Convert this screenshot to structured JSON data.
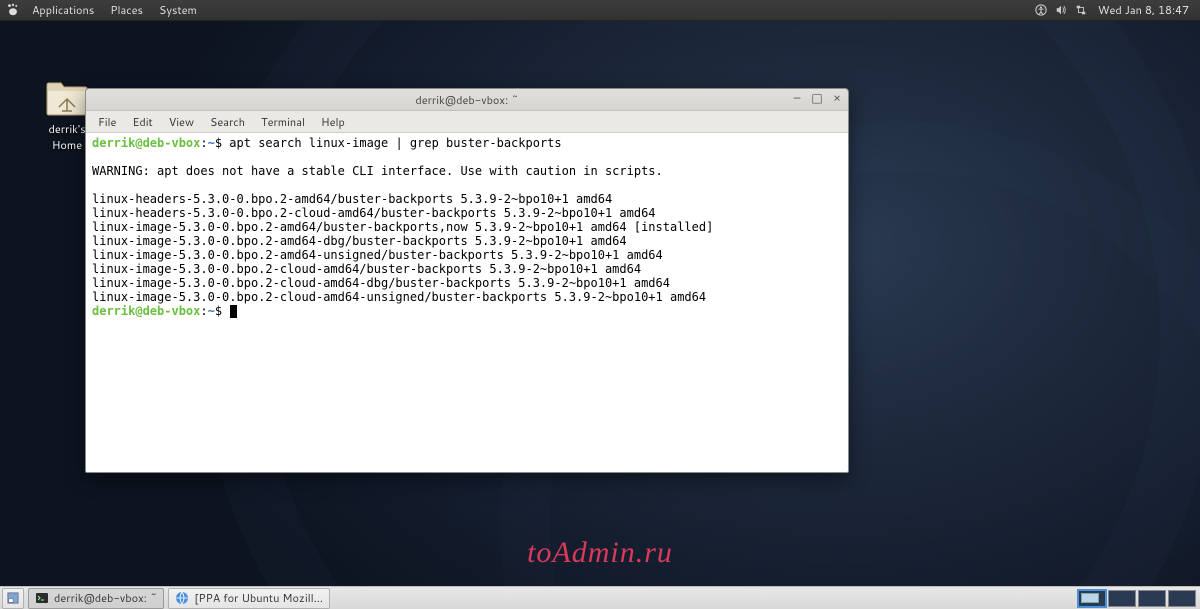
{
  "panel": {
    "menus": [
      "Applications",
      "Places",
      "System"
    ],
    "clock": "Wed Jan  8, 18:47"
  },
  "desktop_icon": {
    "label": "derrik's Home"
  },
  "terminal": {
    "title": "derrik@deb-vbox: ~",
    "menus": [
      "File",
      "Edit",
      "View",
      "Search",
      "Terminal",
      "Help"
    ],
    "prompt": {
      "user": "derrik@deb-vbox",
      "sep1": ":",
      "path": "~",
      "sep2": "$ "
    },
    "command": "apt search linux-image | grep buster-backports",
    "blank1": "",
    "warning": "WARNING: apt does not have a stable CLI interface. Use with caution in scripts.",
    "blank2": "",
    "output": [
      "linux-headers-5.3.0-0.bpo.2-amd64/buster-backports 5.3.9-2~bpo10+1 amd64",
      "linux-headers-5.3.0-0.bpo.2-cloud-amd64/buster-backports 5.3.9-2~bpo10+1 amd64",
      "linux-image-5.3.0-0.bpo.2-amd64/buster-backports,now 5.3.9-2~bpo10+1 amd64 [installed]",
      "linux-image-5.3.0-0.bpo.2-amd64-dbg/buster-backports 5.3.9-2~bpo10+1 amd64",
      "linux-image-5.3.0-0.bpo.2-amd64-unsigned/buster-backports 5.3.9-2~bpo10+1 amd64",
      "linux-image-5.3.0-0.bpo.2-cloud-amd64/buster-backports 5.3.9-2~bpo10+1 amd64",
      "linux-image-5.3.0-0.bpo.2-cloud-amd64-dbg/buster-backports 5.3.9-2~bpo10+1 amd64",
      "linux-image-5.3.0-0.bpo.2-cloud-amd64-unsigned/buster-backports 5.3.9-2~bpo10+1 amd64"
    ]
  },
  "taskbar": {
    "items": [
      {
        "label": "derrik@deb-vbox: ~",
        "icon": "terminal",
        "active": true
      },
      {
        "label": "[PPA for Ubuntu Mozill...",
        "icon": "globe",
        "active": false
      }
    ]
  },
  "watermark": "toAdmin.ru"
}
